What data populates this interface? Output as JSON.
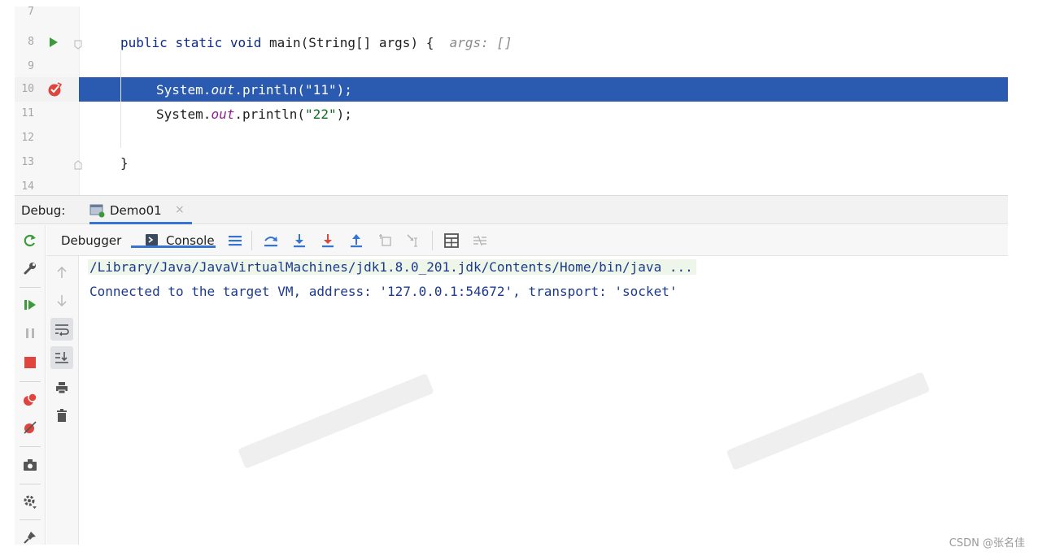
{
  "editor": {
    "lines": [
      {
        "num": "7"
      },
      {
        "num": "8"
      },
      {
        "num": "9"
      },
      {
        "num": "10"
      },
      {
        "num": "11"
      },
      {
        "num": "12"
      },
      {
        "num": "13"
      },
      {
        "num": "14"
      }
    ],
    "line8": {
      "kw1": "public",
      "kw2": "static",
      "kw3": "void",
      "rest": "main(String[] args) {",
      "hint": "args: []"
    },
    "line10": {
      "cls": "System.",
      "field": "out",
      "call": ".println(",
      "str": "\"11\"",
      "end": ");"
    },
    "line11": {
      "cls": "System.",
      "field": "out",
      "call": ".println(",
      "str": "\"22\"",
      "end": ");"
    },
    "line13": {
      "brace": "}"
    },
    "current_line": "10"
  },
  "debug": {
    "label": "Debug:",
    "session_tab": "Demo01",
    "close_glyph": "×"
  },
  "subtabs": {
    "debugger": "Debugger",
    "console": "Console"
  },
  "console": {
    "lines": [
      "/Library/Java/JavaVirtualMachines/jdk1.8.0_201.jdk/Contents/Home/bin/java ...",
      "Connected to the target VM, address: '127.0.0.1:54672', transport: 'socket'"
    ]
  },
  "colors": {
    "accent": "#3574d4",
    "selection": "#2a5bb0",
    "rerun": "#3c9a3c",
    "stop": "#e0443e",
    "breakpoint": "#e0443e"
  },
  "watermark": "CSDN @张名佳"
}
